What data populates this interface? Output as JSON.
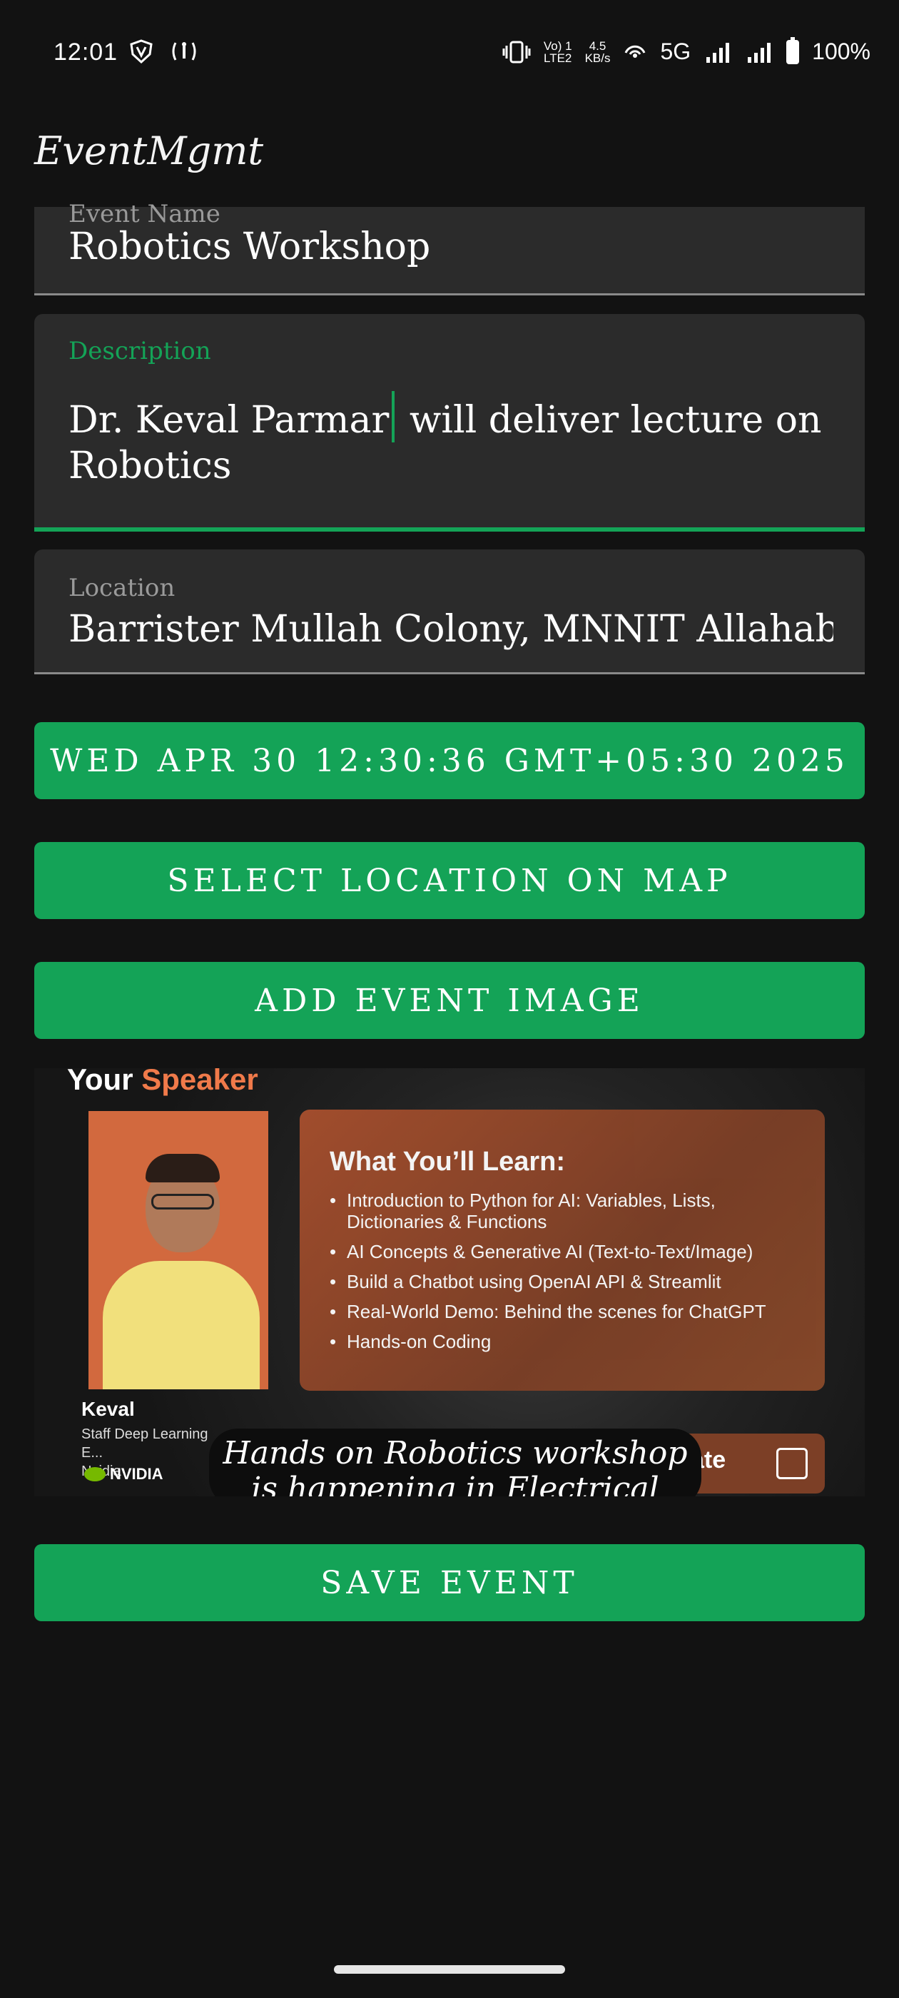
{
  "status_bar": {
    "time": "12:01",
    "network_top": "Vo) 1",
    "network_bottom": "LTE2",
    "speed_top": "4.5",
    "speed_bottom": "KB/s",
    "network_type": "5G",
    "battery": "100%"
  },
  "app": {
    "title": "EventMgmt"
  },
  "form": {
    "event_name": {
      "label": "Event Name",
      "value": "Robotics Workshop"
    },
    "description": {
      "label": "Description",
      "value_before_cursor": "Dr. Keval Parmar",
      "value_after_cursor": " will deliver lecture on Robotics"
    },
    "location": {
      "label": "Location",
      "value": "Barrister Mullah Colony, MNNIT Allahabad Campus"
    }
  },
  "buttons": {
    "date": "WED APR 30 12:30:36 GMT+05:30 2025",
    "select_location": "SELECT LOCATION ON MAP",
    "add_image": "ADD EVENT IMAGE",
    "save": "SAVE EVENT"
  },
  "event_image": {
    "heading_prefix": "Your",
    "heading_accent": "Speaker",
    "learn_title": "What You’ll Learn:",
    "learn_items": [
      "Introduction to Python for AI: Variables, Lists, Dictionaries & Functions",
      "AI Concepts & Generative AI (Text-to-Text/Image)",
      "Build a Chatbot using OpenAI API & Streamlit",
      "Real-World Demo: Behind the scenes for ChatGPT",
      "Hands-on Coding"
    ],
    "speaker_name": "Keval",
    "speaker_role": "Staff Deep Learning E...",
    "speaker_company": "Nvidia",
    "company_logo_text": "NVIDIA",
    "certificate_text": "ate"
  },
  "toast": {
    "message": "Hands on Robotics workshop is happening in Electrical"
  },
  "colors": {
    "accent": "#14a357",
    "background": "#121212",
    "field": "#2b2b2b"
  }
}
